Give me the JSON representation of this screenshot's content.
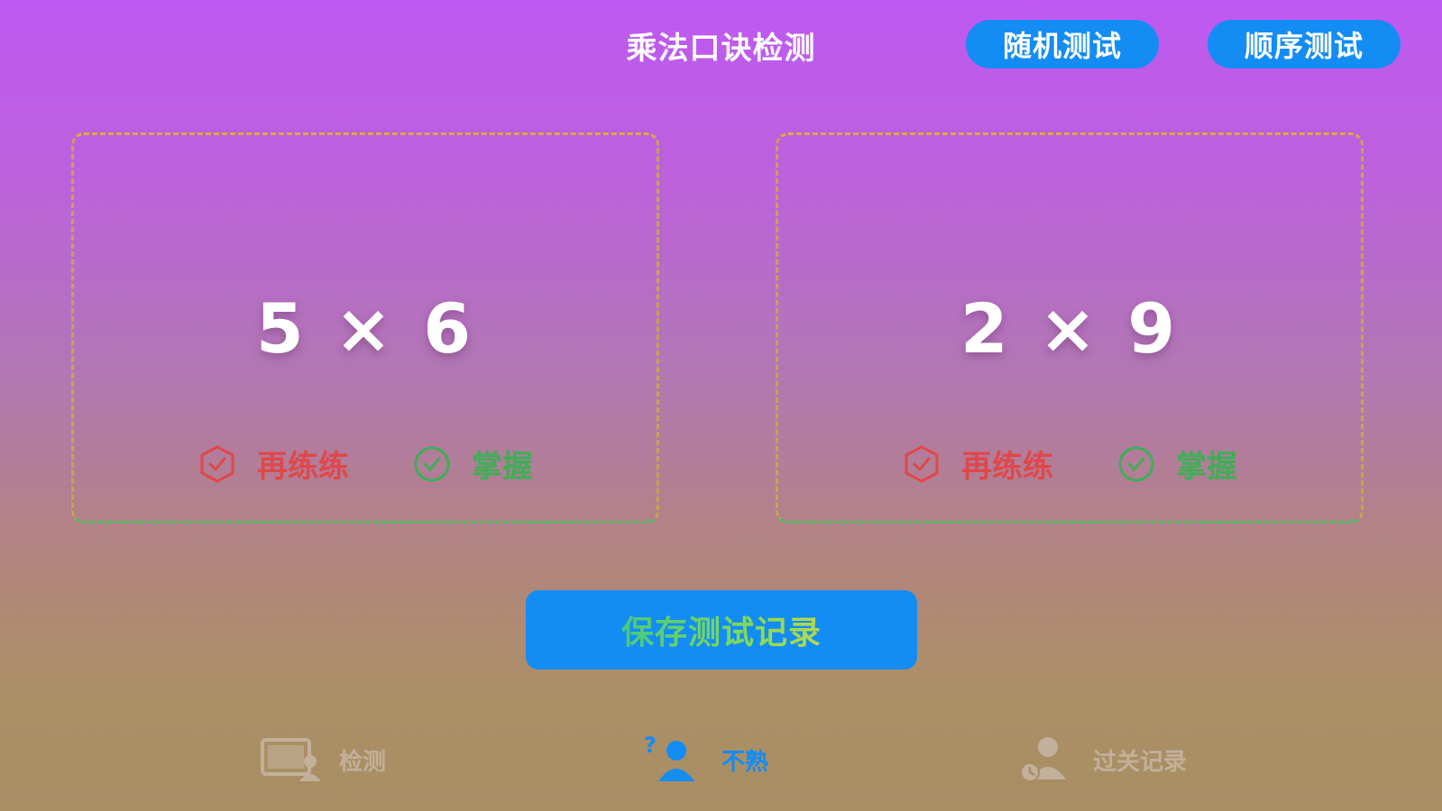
{
  "header": {
    "title": "乘法口诀检测",
    "random_test": "随机测试",
    "sequential_test": "顺序测试"
  },
  "cards": [
    {
      "expression": "5 × 6",
      "retry_label": "再练练",
      "master_label": "掌握"
    },
    {
      "expression": "2 × 9",
      "retry_label": "再练练",
      "master_label": "掌握"
    }
  ],
  "save_button": "保存测试记录",
  "tabs": [
    {
      "label": "检测",
      "icon": "test-screen-icon",
      "active": false
    },
    {
      "label": "不熟",
      "icon": "user-question-icon",
      "active": true
    },
    {
      "label": "过关记录",
      "icon": "user-record-icon",
      "active": false
    }
  ],
  "colors": {
    "accent_blue": "#138cf4",
    "retry_red": "#e0474a",
    "master_green": "#3fae57"
  }
}
